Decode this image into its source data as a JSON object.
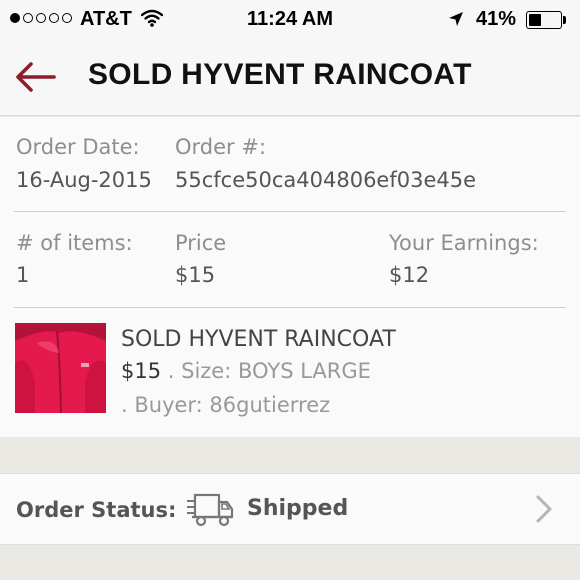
{
  "status_bar": {
    "carrier": "AT&T",
    "time": "11:24 AM",
    "battery_percent": "41%",
    "battery_level": 0.41,
    "signal_bars": 1,
    "signal_total": 5
  },
  "nav": {
    "title": "SOLD HYVENT RAINCOAT",
    "accent_color": "#8b1e2e"
  },
  "order": {
    "date_label": "Order Date:",
    "date_value": "16-Aug-2015",
    "number_label": "Order #:",
    "number_value": "55cfce50ca404806ef03e45e",
    "items_label": "# of items:",
    "items_value": "1",
    "price_label": "Price",
    "price_value": "$15",
    "earnings_label": "Your Earnings:",
    "earnings_value": "$12"
  },
  "item": {
    "title": "SOLD HYVENT RAINCOAT",
    "price": "$15",
    "size_text": " . Size: BOYS LARGE",
    "buyer_text": " . Buyer: 86gutierrez",
    "image_icon": "pink-jacket-photo"
  },
  "order_status": {
    "label": "Order Status:",
    "value": "Shipped",
    "icon": "truck-icon"
  }
}
